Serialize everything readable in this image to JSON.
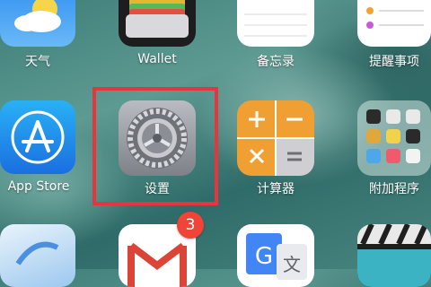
{
  "apps": {
    "weather": {
      "label": "天气"
    },
    "wallet": {
      "label": "Wallet"
    },
    "notes": {
      "label": "备忘录"
    },
    "reminders": {
      "label": "提醒事项"
    },
    "app_store": {
      "label": "App Store"
    },
    "settings": {
      "label": "设置"
    },
    "calculator": {
      "label": "计算器"
    },
    "extras_folder": {
      "label": "附加程序"
    },
    "gmail": {
      "badge": "3"
    }
  },
  "colors": {
    "highlight_border": "#e8353b",
    "badge": "#f04438",
    "calculator_orange": "#f0a033",
    "app_store_blue": "#1a8cf0"
  }
}
